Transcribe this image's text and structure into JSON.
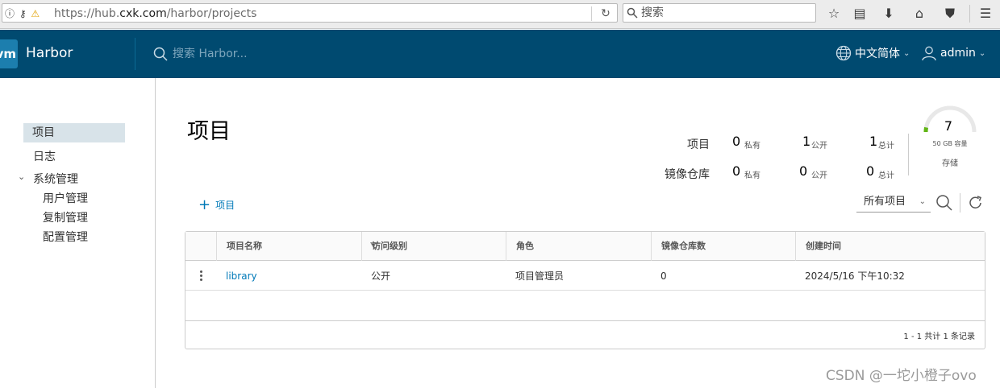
{
  "browser": {
    "url_prefix": "https://hub.",
    "url_host": "cxk.com",
    "url_path": "/harbor/projects",
    "search_placeholder": "搜索"
  },
  "header": {
    "logo_text": "vm",
    "app_name": "Harbor",
    "search_placeholder": "搜索 Harbor...",
    "language": "中文简体",
    "user": "admin"
  },
  "sidebar": {
    "items": [
      {
        "label": "项目"
      },
      {
        "label": "日志"
      },
      {
        "label": "系统管理"
      },
      {
        "label": "用户管理"
      },
      {
        "label": "复制管理"
      },
      {
        "label": "配置管理"
      }
    ]
  },
  "main": {
    "title": "项目",
    "stats": {
      "projects_label": "项目",
      "repos_label": "镜像仓库",
      "private_label": "私有",
      "public_label": "公开",
      "total_label": "总计",
      "projects_private": "0",
      "projects_public": "1",
      "projects_total": "1",
      "repos_private": "0",
      "repos_public": "0",
      "repos_total": "0"
    },
    "storage": {
      "used": "7",
      "capacity_text": "50 GB 容量",
      "label": "存储",
      "fill_ratio": 0.06
    },
    "add_project_label": "项目",
    "filter_value": "所有项目"
  },
  "table": {
    "columns": [
      "项目名称",
      "访问级别",
      "角色",
      "镜像仓库数",
      "创建时间"
    ],
    "rows": [
      {
        "name": "library",
        "access": "公开",
        "role": "项目管理员",
        "repo_count": "0",
        "created": "2024/5/16 下午10:32"
      }
    ],
    "pagination": "1 - 1 共计 1 条记录"
  },
  "watermark": "CSDN @一坨小橙子ovo",
  "colors": {
    "header_bg": "#004a70",
    "link": "#0079b8",
    "active_nav": "#d8e3e9",
    "gauge_fill": "#60b515"
  }
}
